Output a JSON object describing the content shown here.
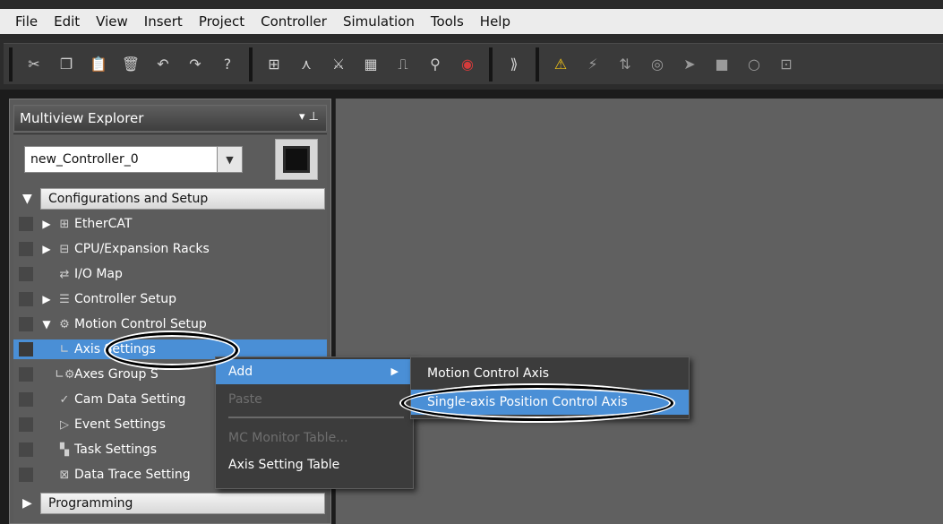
{
  "menubar": {
    "items": [
      "File",
      "Edit",
      "View",
      "Insert",
      "Project",
      "Controller",
      "Simulation",
      "Tools",
      "Help"
    ]
  },
  "toolbar": {
    "icons": [
      "cut-icon",
      "copy-icon",
      "paste-icon",
      "delete-icon",
      "undo-icon",
      "redo-icon",
      "help-icon",
      "rebuild-icon",
      "compile-icon",
      "cross-reference-icon",
      "data-trace-icon",
      "timing-chart-icon",
      "find-icon",
      "check-icon",
      "online-icon",
      "warning-icon",
      "reset-icon",
      "transfer-icon",
      "watch-icon",
      "monitor-icon",
      "stop-icon",
      "io-icon"
    ]
  },
  "explorer": {
    "title": "Multiview Explorer",
    "pin_glyph": "⌄ ⊥",
    "controller": "new_Controller_0",
    "sections": {
      "config": "Configurations and Setup",
      "programming": "Programming"
    },
    "tree": [
      {
        "label": "EtherCAT",
        "expander": "▶",
        "icon": "ethercat-icon"
      },
      {
        "label": "CPU/Expansion Racks",
        "expander": "▶",
        "icon": "rack-icon"
      },
      {
        "label": "I/O Map",
        "expander": "",
        "icon": "io-map-icon"
      },
      {
        "label": "Controller Setup",
        "expander": "▶",
        "icon": "setup-icon"
      },
      {
        "label": "Motion Control Setup",
        "expander": "▼",
        "icon": "gear-icon"
      },
      {
        "label": "Axis Settings",
        "expander": "",
        "icon": "branch-icon"
      },
      {
        "label": "Axes Group S",
        "expander": "",
        "icon": "axes-group-icon"
      },
      {
        "label": "Cam Data Setting",
        "expander": "",
        "icon": "cam-icon"
      },
      {
        "label": "Event Settings",
        "expander": "",
        "icon": "event-icon"
      },
      {
        "label": "Task Settings",
        "expander": "",
        "icon": "task-icon"
      },
      {
        "label": "Data Trace Setting",
        "expander": "",
        "icon": "trace-icon"
      }
    ]
  },
  "context_menu": {
    "add": "Add",
    "paste": "Paste",
    "mc_monitor": "MC Monitor Table...",
    "axis_table": "Axis Setting Table"
  },
  "submenu": {
    "item1": "Motion Control Axis",
    "item2": "Single-axis Position Control Axis"
  }
}
